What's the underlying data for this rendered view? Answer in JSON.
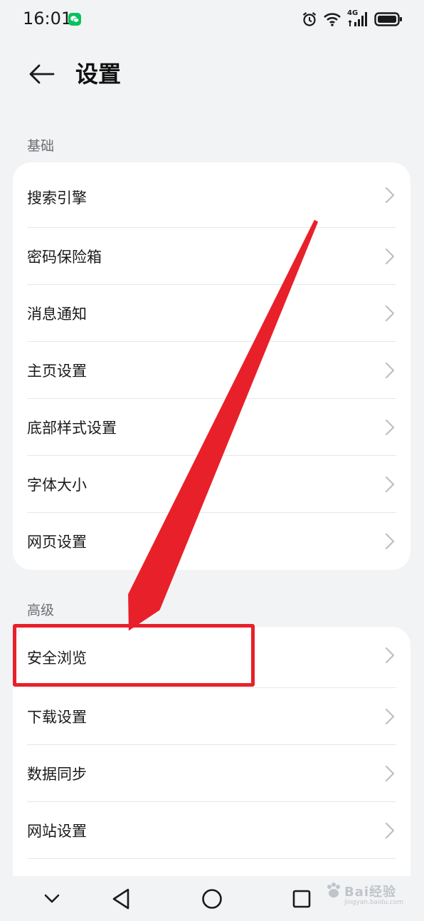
{
  "status_bar": {
    "time": "16:01",
    "icons": [
      "wechat-notification-icon",
      "alarm-icon",
      "wifi-icon",
      "4g-signal-icon",
      "battery-icon"
    ],
    "network_label": "4G"
  },
  "header": {
    "title": "设置",
    "back_icon": "arrow-left-icon"
  },
  "sections": {
    "basic": {
      "label": "基础",
      "items": [
        {
          "label": "搜索引擎"
        },
        {
          "label": "密码保险箱"
        },
        {
          "label": "消息通知"
        },
        {
          "label": "主页设置"
        },
        {
          "label": "底部样式设置"
        },
        {
          "label": "字体大小"
        },
        {
          "label": "网页设置"
        }
      ]
    },
    "advanced": {
      "label": "高级",
      "items": [
        {
          "label": "安全浏览"
        },
        {
          "label": "下载设置"
        },
        {
          "label": "数据同步"
        },
        {
          "label": "网站设置"
        }
      ]
    }
  },
  "nav_bar": {
    "buttons": [
      "collapse-chevron-icon",
      "back-triangle-icon",
      "home-circle-icon",
      "recents-square-icon"
    ]
  },
  "annotation": {
    "highlighted_item": "安全浏览",
    "color": "#e8202a"
  },
  "watermark": {
    "text": "Bai经验",
    "sub": "jingyan.baidu.com"
  },
  "colors": {
    "background": "#f1f3f5",
    "card": "#ffffff",
    "annotation_red": "#e8202a",
    "section_label": "#6b6e72"
  }
}
